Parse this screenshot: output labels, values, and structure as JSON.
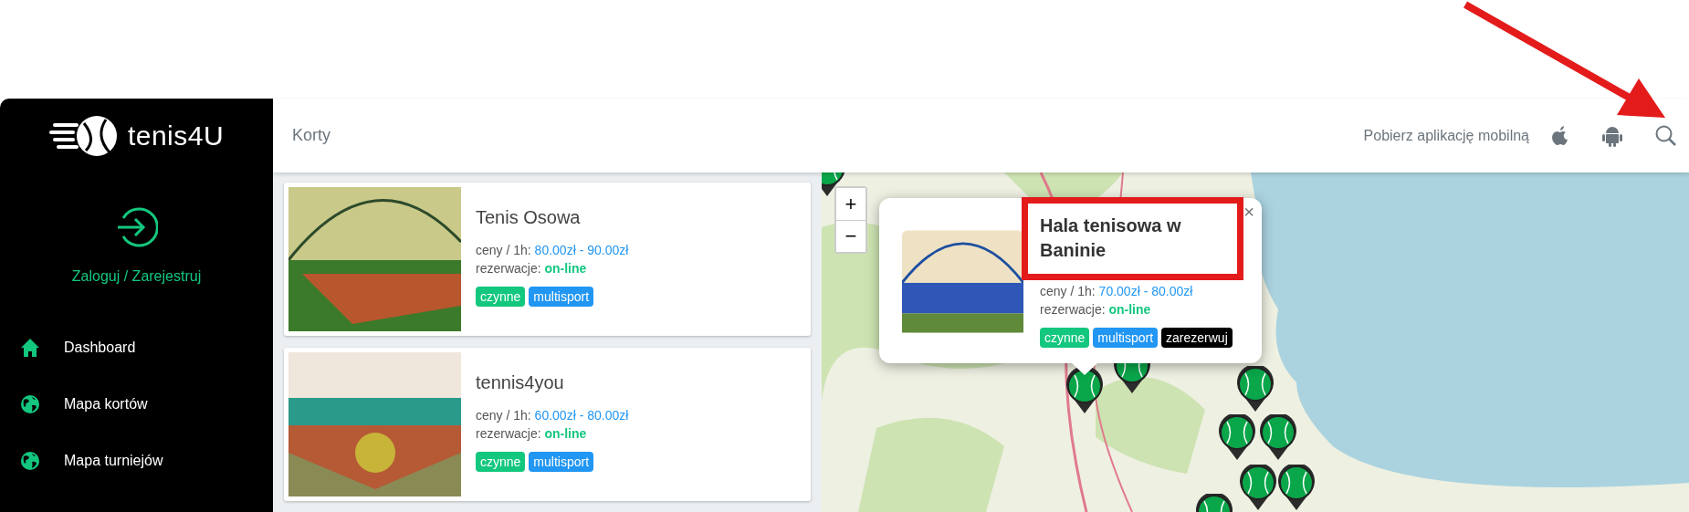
{
  "sidebar": {
    "logo": "tenis**4U**",
    "login": "Zaloguj / Zarejestruj",
    "items": [
      {
        "label": "Dashboard"
      },
      {
        "label": "Mapa kortów"
      },
      {
        "label": "Mapa turniejów"
      }
    ]
  },
  "header": {
    "title": "Korty",
    "app_prompt": "Pobierz aplikację mobilną"
  },
  "courts": [
    {
      "name": "Tenis Osowa",
      "price_label": "ceny / 1h:",
      "price": "80.00zł - 90.00zł",
      "booking_label": "rezerwacje:",
      "booking": "on-line",
      "tags": [
        {
          "label": "czynne",
          "kind": "status"
        },
        {
          "label": "multisport",
          "kind": "category"
        }
      ]
    },
    {
      "name": "tennis4you",
      "price_label": "ceny / 1h:",
      "price": "60.00zł - 80.00zł",
      "booking_label": "rezerwacje:",
      "booking": "on-line",
      "tags": [
        {
          "label": "czynne",
          "kind": "status"
        },
        {
          "label": "multisport",
          "kind": "category"
        }
      ]
    }
  ],
  "map": {
    "zoom_in": "+",
    "zoom_out": "−",
    "popup": {
      "close": "×",
      "name": "Hala tenisowa w Baninie",
      "price_label": "ceny / 1h:",
      "price": "70.00zł - 80.00zł",
      "booking_label": "rezerwacje:",
      "booking": "on-line",
      "tags": [
        {
          "label": "czynne",
          "kind": "status"
        },
        {
          "label": "multisport",
          "kind": "category"
        },
        {
          "label": "zarezerwuj",
          "kind": "action"
        }
      ]
    }
  }
}
